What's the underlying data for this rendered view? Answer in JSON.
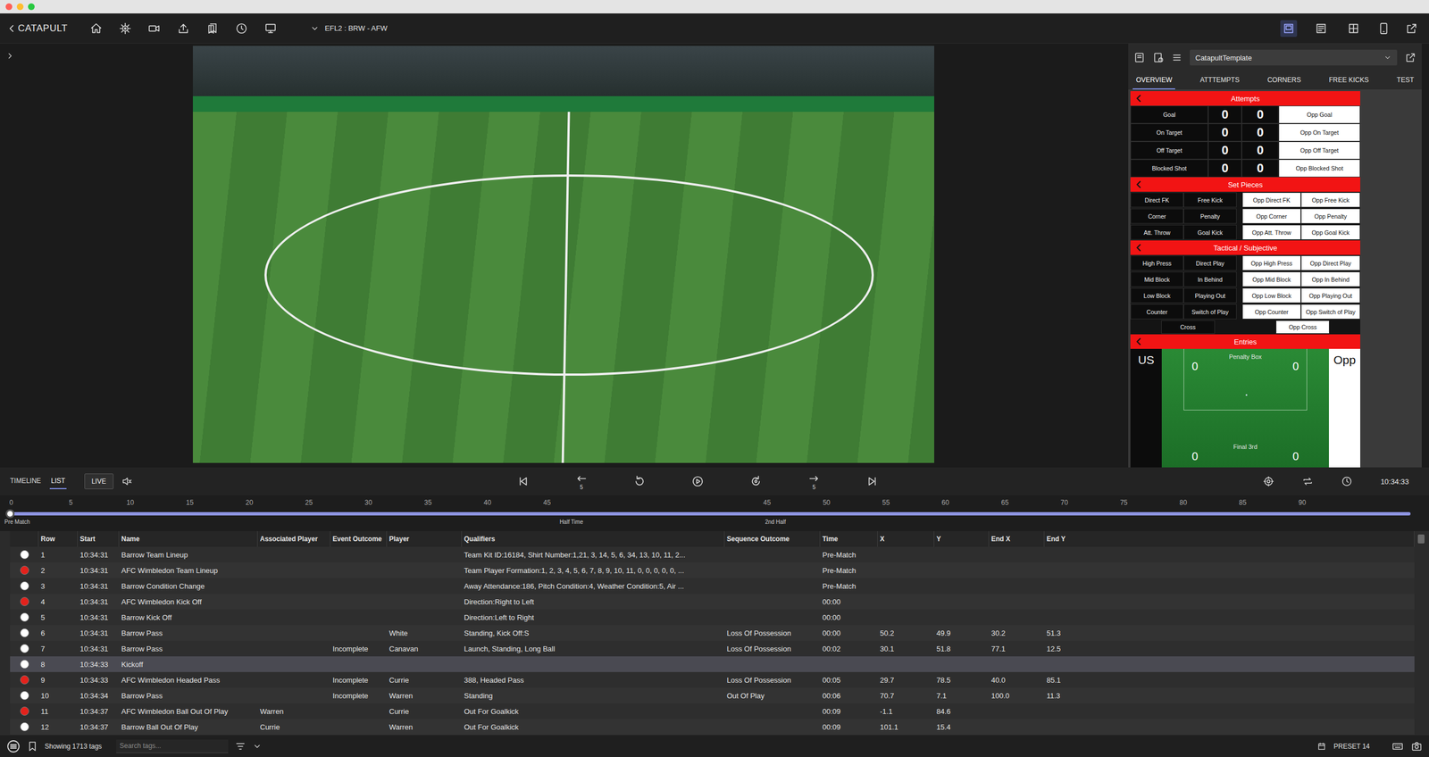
{
  "toolbar": {
    "logo": "CATAPULT",
    "match": "EFL2 : BRW - AFW",
    "layouts": [
      {
        "selected": true
      },
      {
        "selected": false
      },
      {
        "selected": false
      }
    ]
  },
  "panel": {
    "template": "CatapultTemplate",
    "tabs": [
      {
        "label": "OVERVIEW",
        "selected": true
      },
      {
        "label": "ATTTEMPTS",
        "selected": false
      },
      {
        "label": "CORNERS",
        "selected": false
      },
      {
        "label": "FREE KICKS",
        "selected": false
      },
      {
        "label": "TEST",
        "selected": false
      }
    ],
    "attempts": {
      "title": "Attempts",
      "rows": [
        {
          "label": "Goal",
          "us": "0",
          "opp": "0",
          "opp_label": "Opp Goal"
        },
        {
          "label": "On Target",
          "us": "0",
          "opp": "0",
          "opp_label": "Opp On Target"
        },
        {
          "label": "Off Target",
          "us": "0",
          "opp": "0",
          "opp_label": "Opp Off Target"
        },
        {
          "label": "Blocked Shot",
          "us": "0",
          "opp": "0",
          "opp_label": "Opp Blocked Shot"
        }
      ]
    },
    "set_pieces": {
      "title": "Set Pieces",
      "rows": [
        [
          "Direct FK",
          "Free Kick",
          "Opp Direct FK",
          "Opp Free Kick"
        ],
        [
          "Corner",
          "Penalty",
          "Opp Corner",
          "Opp Penalty"
        ],
        [
          "Att. Throw",
          "Goal Kick",
          "Opp Att. Throw",
          "Opp Goal Kick"
        ]
      ]
    },
    "tactical": {
      "title": "Tactical / Subjective",
      "rows": [
        [
          "High Press",
          "Direct Play",
          "Opp High Press",
          "Opp Direct Play"
        ],
        [
          "Mid Block",
          "In Behind",
          "Opp Mid Block",
          "Opp In Behind"
        ],
        [
          "Low Block",
          "Playing Out",
          "Opp Low Block",
          "Opp Playing Out"
        ],
        [
          "Counter",
          "Switch of Play",
          "Opp Counter",
          "Opp Switch of Play"
        ]
      ],
      "cross": [
        "Cross",
        "Opp Cross"
      ]
    },
    "entries": {
      "title": "Entries",
      "us": "US",
      "opp": "Opp",
      "penalty_box": "Penalty Box",
      "box_us": "0",
      "box_opp": "0",
      "final_third": "Final 3rd",
      "final_us": "0",
      "final_opp": "0"
    }
  },
  "controls": {
    "views": [
      {
        "label": "TIMELINE",
        "selected": false
      },
      {
        "label": "LIST",
        "selected": true
      }
    ],
    "live": "LIVE",
    "rewind_label": "5",
    "forward_label": "5",
    "clock": "10:34:33"
  },
  "timeline": {
    "first_half": [
      "0",
      "5",
      "10",
      "15",
      "20",
      "25",
      "30",
      "35",
      "40",
      "45"
    ],
    "second_half": [
      "45",
      "50",
      "55",
      "60",
      "65",
      "70",
      "75",
      "80",
      "85",
      "90"
    ],
    "markers": [
      "Pre Match",
      "Half Time",
      "2nd Half"
    ]
  },
  "table": {
    "columns": [
      "Row",
      "Start",
      "Name",
      "Associated Player",
      "Event Outcome",
      "Player",
      "Qualifiers",
      "Sequence Outcome",
      "Time",
      "X",
      "Y",
      "End X",
      "End Y"
    ],
    "rows": [
      {
        "color": "#ffffff",
        "selected": false,
        "cells": [
          "1",
          "10:34:31",
          "Barrow Team Lineup",
          "",
          "",
          "",
          "Team Kit ID:16184, Shirt Number:1,21, 3, 14, 5, 6, 34, 13, 10, 11, 2...",
          "",
          "Pre-Match",
          "",
          "",
          "",
          ""
        ]
      },
      {
        "color": "#e3221c",
        "selected": false,
        "cells": [
          "2",
          "10:34:31",
          "AFC Wimbledon Team Lineup",
          "",
          "",
          "",
          "Team Player Formation:1, 2, 3, 4, 5, 6, 7, 8, 9, 10, 11, 0, 0, 0, 0, 0, ...",
          "",
          "Pre-Match",
          "",
          "",
          "",
          ""
        ]
      },
      {
        "color": "#ffffff",
        "selected": false,
        "cells": [
          "3",
          "10:34:31",
          "Barrow Condition Change",
          "",
          "",
          "",
          "Away Attendance:186, Pitch Condition:4, Weather Condition:5, Air ...",
          "",
          "Pre-Match",
          "",
          "",
          "",
          ""
        ]
      },
      {
        "color": "#e3221c",
        "selected": false,
        "cells": [
          "4",
          "10:34:31",
          "AFC Wimbledon Kick Off",
          "",
          "",
          "",
          "Direction:Right to Left",
          "",
          "00:00",
          "",
          "",
          "",
          ""
        ]
      },
      {
        "color": "#ffffff",
        "selected": false,
        "cells": [
          "5",
          "10:34:31",
          "Barrow Kick Off",
          "",
          "",
          "",
          "Direction:Left to Right",
          "",
          "00:00",
          "",
          "",
          "",
          ""
        ]
      },
      {
        "color": "#ffffff",
        "selected": false,
        "cells": [
          "6",
          "10:34:31",
          "Barrow Pass",
          "",
          "",
          "White",
          "Standing, Kick Off:S",
          "Loss Of Possession",
          "00:00",
          "50.2",
          "49.9",
          "30.2",
          "51.3"
        ]
      },
      {
        "color": "#ffffff",
        "selected": false,
        "cells": [
          "7",
          "10:34:31",
          "Barrow Pass",
          "",
          "Incomplete",
          "Canavan",
          "Launch, Standing, Long Ball",
          "Loss Of Possession",
          "00:02",
          "30.1",
          "51.8",
          "77.1",
          "12.5"
        ]
      },
      {
        "color": "#ffffff",
        "selected": true,
        "cells": [
          "8",
          "10:34:33",
          "Kickoff",
          "",
          "",
          "",
          "",
          "",
          "",
          "",
          "",
          "",
          ""
        ]
      },
      {
        "color": "#e3221c",
        "selected": false,
        "cells": [
          "9",
          "10:34:33",
          "AFC Wimbledon Headed Pass",
          "",
          "Incomplete",
          "Currie",
          "388, Headed Pass",
          "Loss Of Possession",
          "00:05",
          "29.7",
          "78.5",
          "40.0",
          "85.1"
        ]
      },
      {
        "color": "#ffffff",
        "selected": false,
        "cells": [
          "10",
          "10:34:34",
          "Barrow Pass",
          "",
          "Incomplete",
          "Warren",
          "Standing",
          "Out Of Play",
          "00:06",
          "70.7",
          "7.1",
          "100.0",
          "11.3"
        ]
      },
      {
        "color": "#e3221c",
        "selected": false,
        "cells": [
          "11",
          "10:34:37",
          "AFC Wimbledon Ball Out Of Play",
          "Warren",
          "",
          "Currie",
          "Out For Goalkick",
          "",
          "00:09",
          "-1.1",
          "84.6",
          "",
          ""
        ]
      },
      {
        "color": "#ffffff",
        "selected": false,
        "cells": [
          "12",
          "10:34:37",
          "Barrow Ball Out Of Play",
          "Currie",
          "",
          "Warren",
          "Out For Goalkick",
          "",
          "00:09",
          "101.1",
          "15.4",
          "",
          ""
        ]
      }
    ]
  },
  "status_bar": {
    "count": "Showing 1713 tags",
    "search_placeholder": "Search tags...",
    "preset": "PRESET 14"
  }
}
